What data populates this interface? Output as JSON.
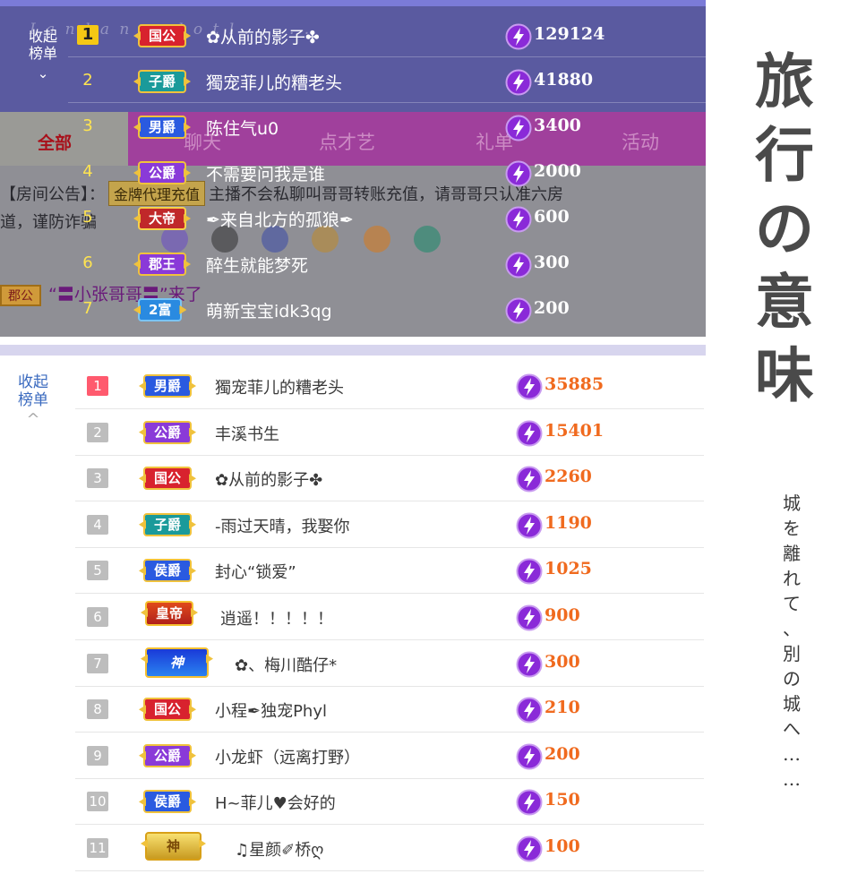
{
  "top_panel": {
    "collapse_label_1": "收起",
    "collapse_label_2": "榜单",
    "collapse_icon": "chevron-down-icon",
    "watermark": "I a n l a n o o l o t l . . . . .",
    "tabs": {
      "all": "全部",
      "chat": "聊天",
      "talent": "点才艺",
      "gifts": "礼单",
      "activity": "活动"
    },
    "notice": {
      "prefix": "【房间公告】：",
      "tag": "金牌代理充值",
      "text": "主播不会私聊叫哥哥转账充值，请哥哥只认准六房",
      "line2": "道，谨防诈骗"
    },
    "entry": {
      "level": "郡公",
      "text": "“〓小张哥哥〓”来了"
    },
    "rows": [
      {
        "rank": "1",
        "title": "国公",
        "title_style": "red",
        "name": "✿从前的影子✤",
        "score": "129124"
      },
      {
        "rank": "2",
        "title": "子爵",
        "title_style": "teal",
        "name": "獨宠菲儿的糟老头",
        "score": "41880"
      },
      {
        "rank": "3",
        "title": "男爵",
        "title_style": "blue",
        "name": "陈住气u0",
        "score": "3400"
      },
      {
        "rank": "4",
        "title": "公爵",
        "title_style": "purple",
        "name": "不需要问我是谁",
        "score": "2000"
      },
      {
        "rank": "5",
        "title": "大帝",
        "title_style": "royal",
        "name": "✒来自北方的孤狼✒",
        "score": "600"
      },
      {
        "rank": "6",
        "title": "郡王",
        "title_style": "purple",
        "name": "醉生就能梦死",
        "score": "300"
      },
      {
        "rank": "7",
        "title": "2富",
        "title_style": "rich",
        "name": "萌新宝宝idk3qg",
        "score": "200"
      }
    ]
  },
  "bottom_list": {
    "collapse_label_1": "收起",
    "collapse_label_2": "榜单",
    "collapse_icon": "chevron-up-icon",
    "rows": [
      {
        "rank": "1",
        "title": "男爵",
        "title_style": "blue",
        "name": "獨宠菲儿的糟老头",
        "score": "35885"
      },
      {
        "rank": "2",
        "title": "公爵",
        "title_style": "purple",
        "name": "丰溪书生",
        "score": "15401"
      },
      {
        "rank": "3",
        "title": "国公",
        "title_style": "red",
        "name": "✿从前的影子✤",
        "score": "2260"
      },
      {
        "rank": "4",
        "title": "子爵",
        "title_style": "teal",
        "name": "-雨过天晴，我娶你",
        "score": "1190"
      },
      {
        "rank": "5",
        "title": "侯爵",
        "title_style": "blue",
        "name": "封心“锁爱”",
        "score": "1025"
      },
      {
        "rank": "6",
        "title": "皇帝",
        "title_style": "emperor",
        "name": "逍遥！！！！！",
        "score": "900"
      },
      {
        "rank": "7",
        "title": "神",
        "title_style": "god",
        "name": "✿、梅川酷仔*",
        "score": "300"
      },
      {
        "rank": "8",
        "title": "国公",
        "title_style": "red",
        "name": "小程✒独宠Phyl",
        "score": "210"
      },
      {
        "rank": "9",
        "title": "公爵",
        "title_style": "purple",
        "name": "小龙虾（远离打野）",
        "score": "200"
      },
      {
        "rank": "10",
        "title": "侯爵",
        "title_style": "blue",
        "name": "H~菲儿♥会好的",
        "score": "150"
      },
      {
        "rank": "11",
        "title": "神",
        "title_style": "god2",
        "name": "♫星颜✐桥ღ",
        "score": "100"
      }
    ]
  },
  "decoration": {
    "title": [
      "旅",
      "行",
      "の",
      "意",
      "味"
    ],
    "subtitle": [
      "城",
      "を",
      "離",
      "れ",
      "て",
      "、",
      "別",
      "の",
      "城",
      "へ",
      "…",
      "…"
    ]
  },
  "colors": {
    "top_list_bg": "#5a5aa0",
    "tab_bar": "#a0409c",
    "score_orange": "#f06a1e",
    "rank_first": "#ff5a6e",
    "bolt_purple": "#8a2ad8"
  },
  "icons": {
    "score": "lightning-bolt-icon"
  }
}
